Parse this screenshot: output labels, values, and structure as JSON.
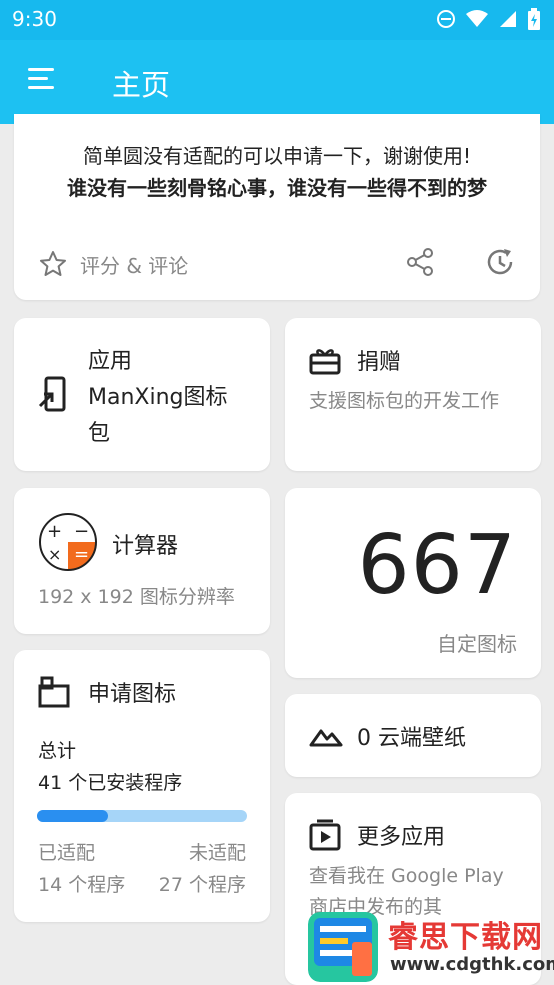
{
  "status": {
    "time": "9:30"
  },
  "appbar": {
    "title": "主页"
  },
  "top": {
    "line1": "简单圆没有适配的可以申请一下，谢谢使用!",
    "line2": "谁没有一些刻骨铭心事，谁没有一些得不到的梦",
    "rate_label": "评分 & 评论"
  },
  "apply": {
    "title": "应用\nManXing图标\n包"
  },
  "donate": {
    "title": "捐赠",
    "subtitle": "支援图标包的开发工作"
  },
  "calc": {
    "title": "计算器",
    "subtitle": "192 x 192 图标分辨率"
  },
  "count": {
    "number": "667",
    "caption": "自定图标"
  },
  "request": {
    "title": "申请图标",
    "total_label": "总计",
    "installed": "41 个已安装程序",
    "progress": 0.34,
    "done_label": "已适配",
    "todo_label": "未适配",
    "done_value": "14 个程序",
    "todo_value": "27 个程序"
  },
  "wall": {
    "title": "0 云端壁纸"
  },
  "more": {
    "title": "更多应用",
    "subtitle": "查看我在 Google Play 商店中发布的其"
  },
  "watermark": {
    "name": "睿思下载网",
    "url": "www.cdgthk.com"
  },
  "colors": {
    "appbar": "#1dc1f2",
    "progress_fill": "#2a8ff0",
    "progress_bg": "#a6d5f8",
    "calc_orange": "#f26b1d"
  }
}
